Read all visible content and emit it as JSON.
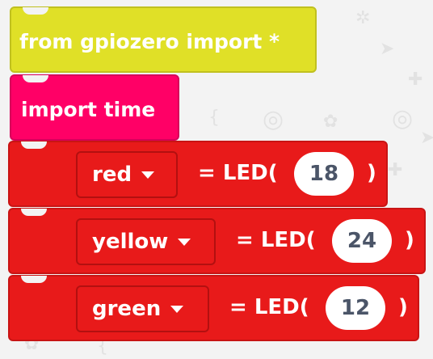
{
  "background_icons": [
    "gear-icon",
    "plus-icon",
    "python-icon",
    "circle-icon",
    "cursor-icon",
    "curly-brace-icon"
  ],
  "colors": {
    "import_block": "#e0e027",
    "time_block": "#ff0066",
    "led_block": "#e81a1a",
    "pin_text": "#4b5568"
  },
  "blocks": {
    "import_gpiozero": {
      "text": "from gpiozero import *"
    },
    "import_time": {
      "text": "import time"
    },
    "leds": [
      {
        "variable": "red",
        "assign": "= LED(",
        "pin": "18",
        "close": ")"
      },
      {
        "variable": "yellow",
        "assign": "= LED(",
        "pin": "24",
        "close": ")"
      },
      {
        "variable": "green",
        "assign": "= LED(",
        "pin": "12",
        "close": ")"
      }
    ]
  }
}
